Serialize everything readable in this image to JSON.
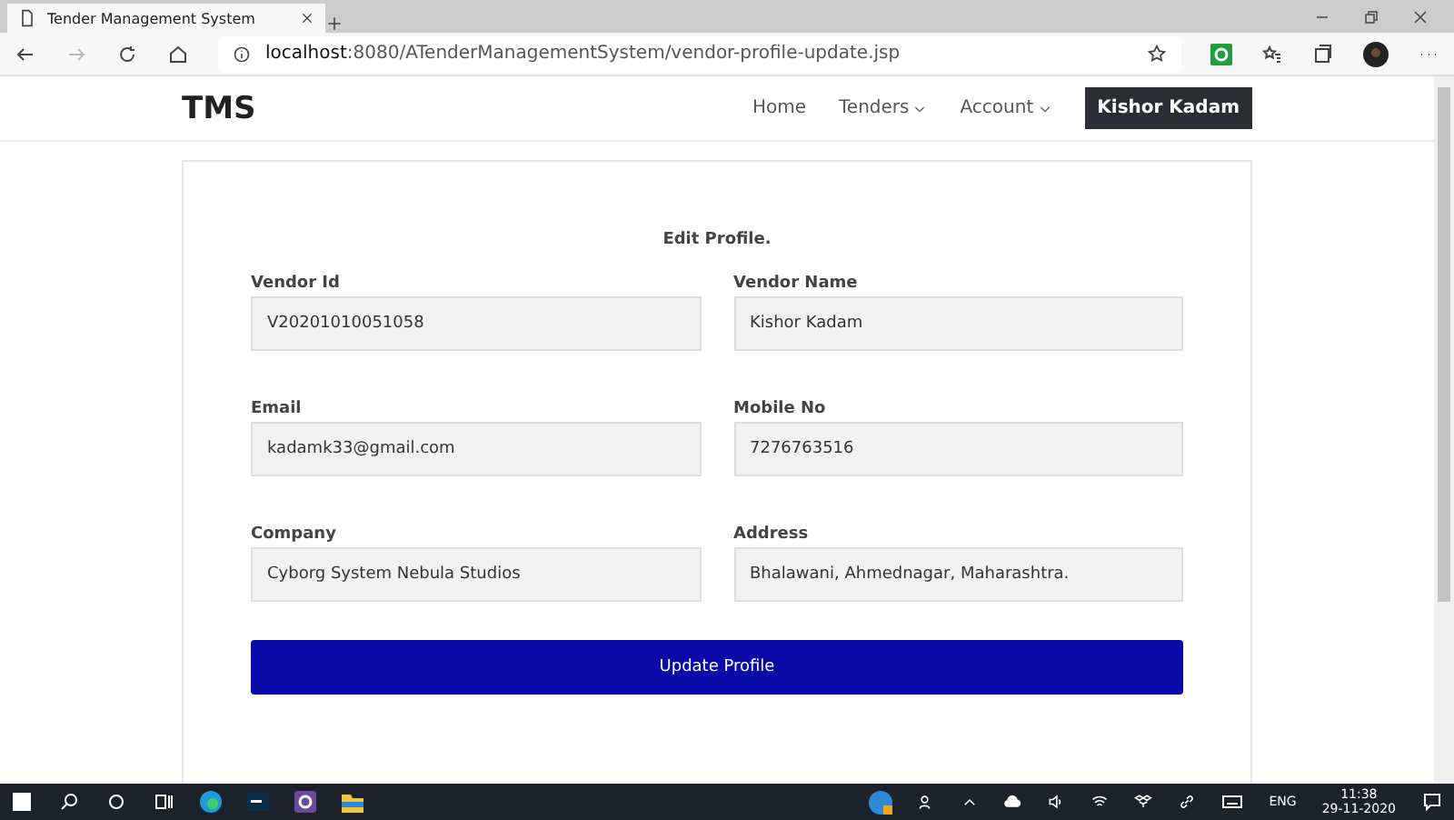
{
  "browser": {
    "tab_title": "Tender Management System",
    "url_host": "localhost",
    "url_rest": ":8080/ATenderManagementSystem/vendor-profile-update.jsp"
  },
  "navbar": {
    "brand": "TMS",
    "links": [
      {
        "label": "Home",
        "dropdown": false
      },
      {
        "label": "Tenders",
        "dropdown": true
      },
      {
        "label": "Account",
        "dropdown": true
      }
    ],
    "user": "Kishor Kadam"
  },
  "form": {
    "title": "Edit Profile.",
    "fields": [
      {
        "label": "Vendor Id",
        "value": "V20201010051058"
      },
      {
        "label": "Vendor Name",
        "value": "Kishor Kadam"
      },
      {
        "label": "Email",
        "value": "kadamk33@gmail.com"
      },
      {
        "label": "Mobile No",
        "value": "7276763516"
      },
      {
        "label": "Company",
        "value": "Cyborg System Nebula Studios"
      },
      {
        "label": "Address",
        "value": "Bhalawani, Ahmednagar, Maharashtra."
      }
    ],
    "submit": "Update Profile"
  },
  "taskbar": {
    "language": "ENG",
    "time": "11:38",
    "date": "29-11-2020"
  }
}
